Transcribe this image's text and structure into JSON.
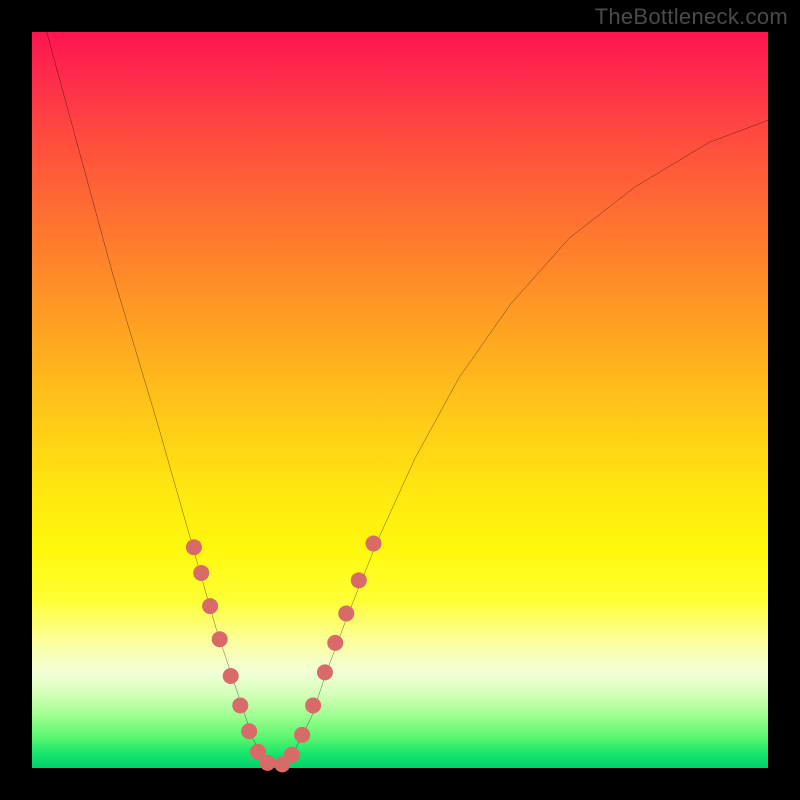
{
  "watermark": "TheBottleneck.com",
  "chart_data": {
    "type": "line",
    "title": "",
    "xlabel": "",
    "ylabel": "",
    "xlim": [
      0,
      100
    ],
    "ylim": [
      0,
      100
    ],
    "grid": false,
    "series": [
      {
        "name": "bottleneck-curve",
        "x": [
          2,
          5,
          8,
          11,
          14,
          17,
          19,
          21,
          23,
          25,
          27,
          28,
          29,
          30,
          31,
          32,
          33,
          34,
          35,
          36,
          38,
          40,
          43,
          47,
          52,
          58,
          65,
          73,
          82,
          92,
          100
        ],
        "y": [
          100,
          89,
          78,
          67,
          57,
          47,
          40,
          33,
          26,
          19,
          13,
          10,
          7,
          4,
          2,
          1,
          0,
          0,
          1,
          3,
          7,
          13,
          21,
          31,
          42,
          53,
          63,
          72,
          79,
          85,
          88
        ],
        "stroke": "#000000",
        "stroke_width": 2.2
      }
    ],
    "markers": [
      {
        "series": "dots-left",
        "color": "#d86a68",
        "radius": 8,
        "points": [
          {
            "x": 22.0,
            "y": 30.0
          },
          {
            "x": 23.0,
            "y": 26.5
          },
          {
            "x": 24.2,
            "y": 22.0
          },
          {
            "x": 25.5,
            "y": 17.5
          },
          {
            "x": 27.0,
            "y": 12.5
          },
          {
            "x": 28.3,
            "y": 8.5
          },
          {
            "x": 29.5,
            "y": 5.0
          },
          {
            "x": 30.7,
            "y": 2.2
          },
          {
            "x": 32.0,
            "y": 0.7
          }
        ]
      },
      {
        "series": "dots-right",
        "color": "#d86a68",
        "radius": 8,
        "points": [
          {
            "x": 34.0,
            "y": 0.5
          },
          {
            "x": 35.3,
            "y": 1.8
          },
          {
            "x": 36.7,
            "y": 4.5
          },
          {
            "x": 38.2,
            "y": 8.5
          },
          {
            "x": 39.8,
            "y": 13.0
          },
          {
            "x": 41.2,
            "y": 17.0
          },
          {
            "x": 42.7,
            "y": 21.0
          },
          {
            "x": 44.4,
            "y": 25.5
          },
          {
            "x": 46.4,
            "y": 30.5
          }
        ]
      }
    ],
    "background_gradient": {
      "stops": [
        {
          "pos": 0.0,
          "color": "#ff1450"
        },
        {
          "pos": 0.24,
          "color": "#ff6c33"
        },
        {
          "pos": 0.54,
          "color": "#ffce16"
        },
        {
          "pos": 0.77,
          "color": "#ffff32"
        },
        {
          "pos": 0.9,
          "color": "#d4ffb8"
        },
        {
          "pos": 1.0,
          "color": "#00d26a"
        }
      ]
    }
  }
}
